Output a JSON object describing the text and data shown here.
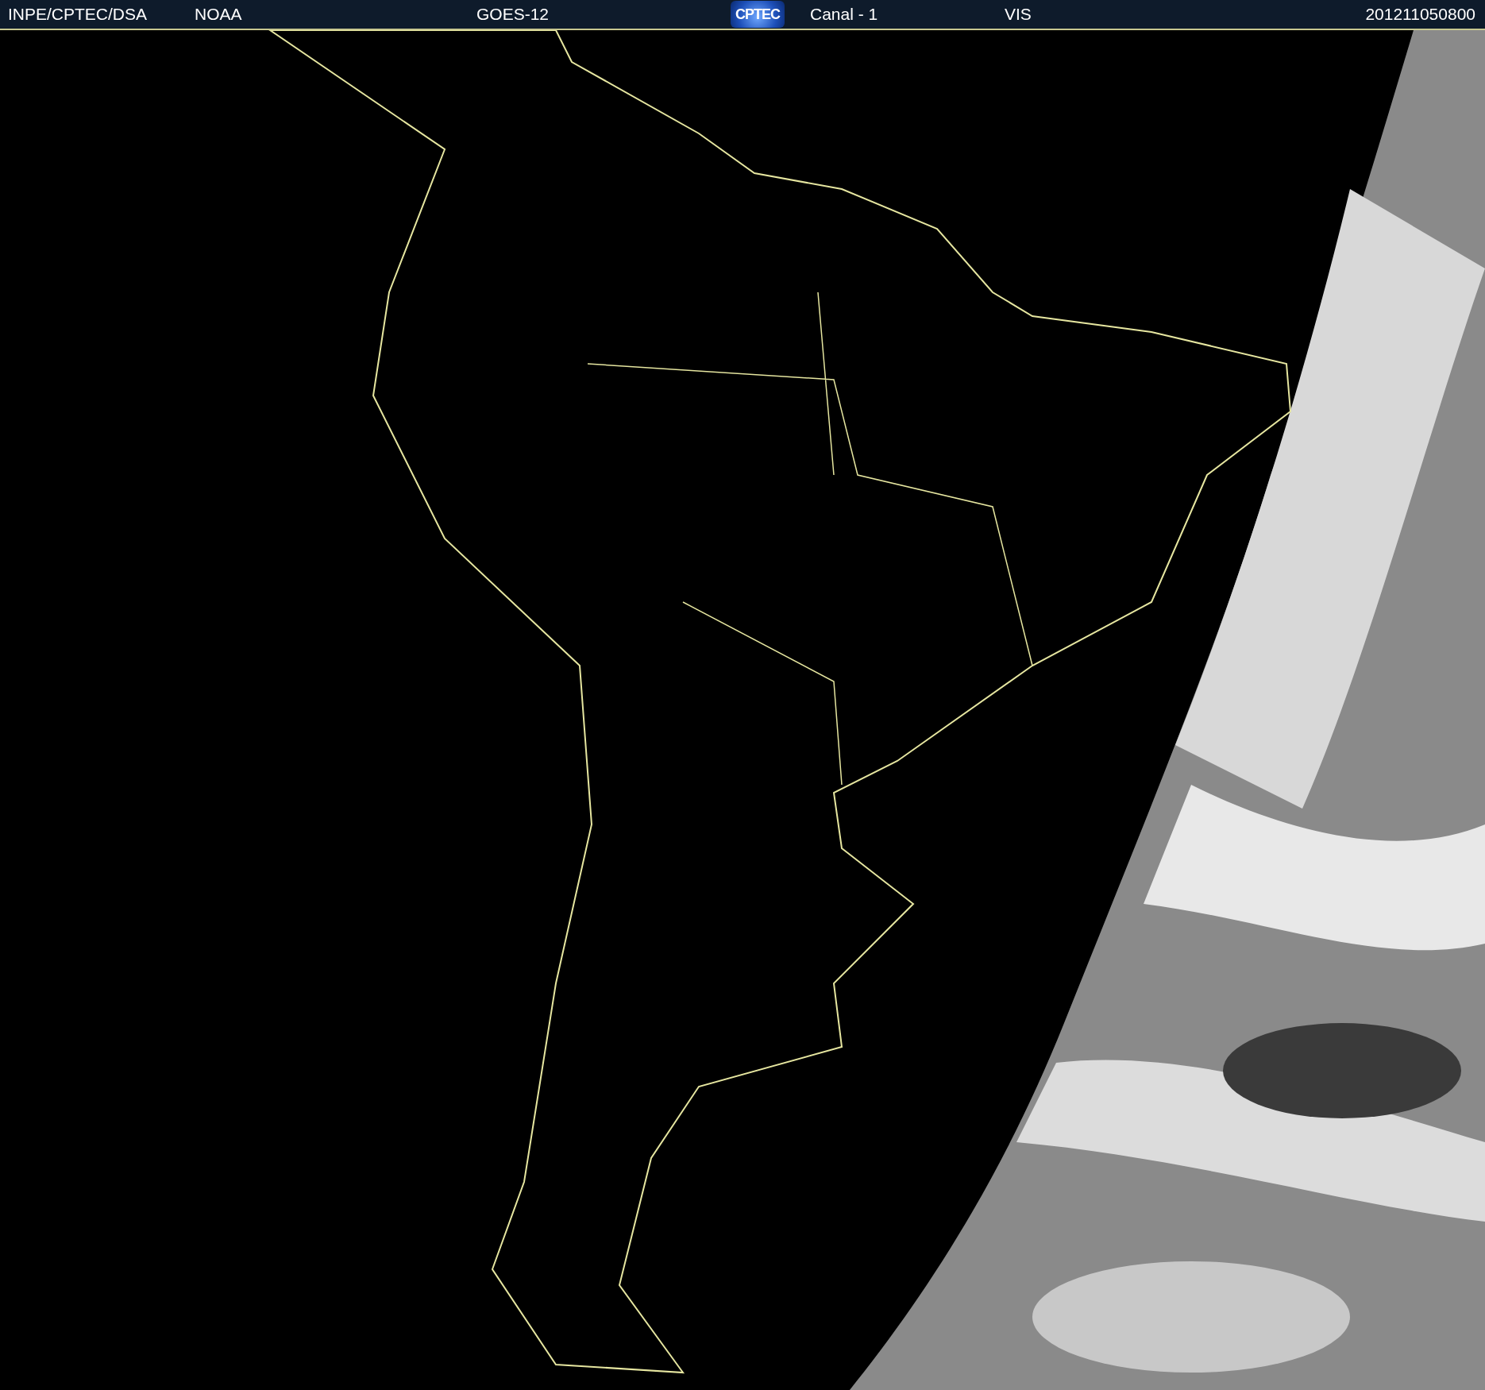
{
  "header": {
    "items": [
      {
        "kind": "text",
        "text": "INPE/CPTEC/DSA"
      },
      {
        "kind": "text",
        "text": "NOAA"
      },
      {
        "kind": "text",
        "text": "GOES-12"
      },
      {
        "kind": "logo",
        "text": "CPTEC"
      },
      {
        "kind": "text",
        "text": "Canal - 1"
      },
      {
        "kind": "text",
        "text": "VIS"
      },
      {
        "kind": "text",
        "text": "201211050800"
      }
    ]
  }
}
